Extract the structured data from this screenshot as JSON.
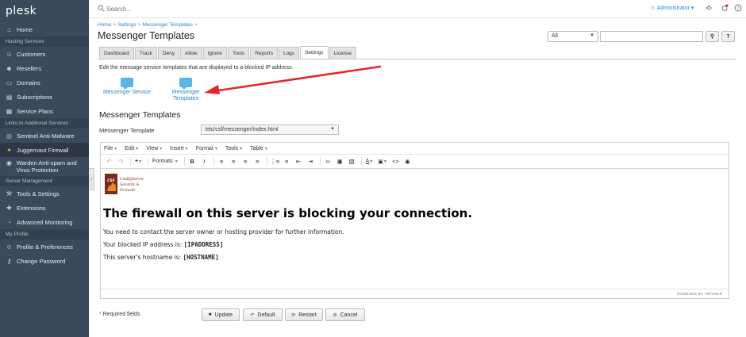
{
  "app": {
    "logo": "plesk"
  },
  "sidebar": {
    "items_top": [
      {
        "label": "Home",
        "icon": "home-icon",
        "glyph": "⌂"
      }
    ],
    "sections": [
      {
        "title": "Hosting Services",
        "items": [
          {
            "label": "Customers",
            "glyph": "☺"
          },
          {
            "label": "Resellers",
            "glyph": "☻"
          },
          {
            "label": "Domains",
            "glyph": "▭"
          },
          {
            "label": "Subscriptions",
            "glyph": "▤"
          },
          {
            "label": "Service Plans",
            "glyph": "▦"
          }
        ]
      },
      {
        "title": "Links to Additional Services",
        "items": [
          {
            "label": "Sentinel Anti-Malware",
            "glyph": "◎"
          },
          {
            "label": "Juggernaut Firewall",
            "glyph": "✦",
            "active": true
          },
          {
            "label": "Warden Anti-spam and Virus Protection",
            "glyph": "◉",
            "tall": true
          }
        ]
      },
      {
        "title": "Server Management",
        "items": [
          {
            "label": "Tools & Settings",
            "glyph": "⚒"
          },
          {
            "label": "Extensions",
            "glyph": "✚"
          },
          {
            "label": "Advanced Monitoring",
            "glyph": "◔"
          }
        ]
      },
      {
        "title": "My Profile",
        "items": [
          {
            "label": "Profile & Preferences",
            "glyph": "☺"
          },
          {
            "label": "Change Password",
            "glyph": "⚷"
          }
        ]
      }
    ],
    "collapse_glyph": "‹"
  },
  "topbar": {
    "search_placeholder": "Search...",
    "user": "Administrator",
    "user_caret": "▾"
  },
  "breadcrumb": [
    "Home",
    "Settings",
    "Messenger Templates"
  ],
  "breadcrumb_sep": ">",
  "page_title": "Messenger Templates",
  "filter": {
    "selected": "All",
    "search_glyph": "⚲",
    "help_glyph": "?"
  },
  "tabs": [
    {
      "label": "Dashboard"
    },
    {
      "label": "Track"
    },
    {
      "label": "Deny"
    },
    {
      "label": "Allow"
    },
    {
      "label": "Ignore"
    },
    {
      "label": "Tools"
    },
    {
      "label": "Reports"
    },
    {
      "label": "Logs"
    },
    {
      "label": "Settings",
      "active": true
    },
    {
      "label": "License"
    }
  ],
  "description": "Edit the message service templates that are displayed to a blocked IP address.",
  "tiles": [
    {
      "label": "Messenger Service"
    },
    {
      "label_line1": "Messenger",
      "label_line2": "Templates"
    }
  ],
  "section_title": "Messenger Templates",
  "form": {
    "template_label": "Messenger Template",
    "template_value": "/etc/csf/messenger/index.html"
  },
  "editor": {
    "menus": [
      "File",
      "Edit",
      "View",
      "Insert",
      "Format",
      "Tools",
      "Table"
    ],
    "formats_label": "Formats",
    "logo_lines": [
      "ConfigServer",
      "Security &",
      "Firewall"
    ],
    "logo_badge": "CSF",
    "heading": "The firewall on this server is blocking your connection.",
    "p1": "You need to contact the server owner or hosting provider for further information.",
    "p2_prefix": "Your blocked IP address is: ",
    "p2_var": "[IPADDRESS]",
    "p3_prefix": "This server's hostname is: ",
    "p3_var": "[HOSTNAME]",
    "powered_by": "POWERED BY TINYMCE"
  },
  "footer": {
    "required_star": "*",
    "required_text": " Required fields",
    "buttons": [
      {
        "label": "Update",
        "glyph": "■"
      },
      {
        "label": "Default",
        "glyph": "↶"
      },
      {
        "label": "Restart",
        "glyph": "⟳"
      },
      {
        "label": "Cancel",
        "glyph": "⊘"
      }
    ]
  },
  "colors": {
    "sidebar": "#3b4a5a",
    "link": "#2b86c5",
    "arrow": "#e8262b"
  }
}
